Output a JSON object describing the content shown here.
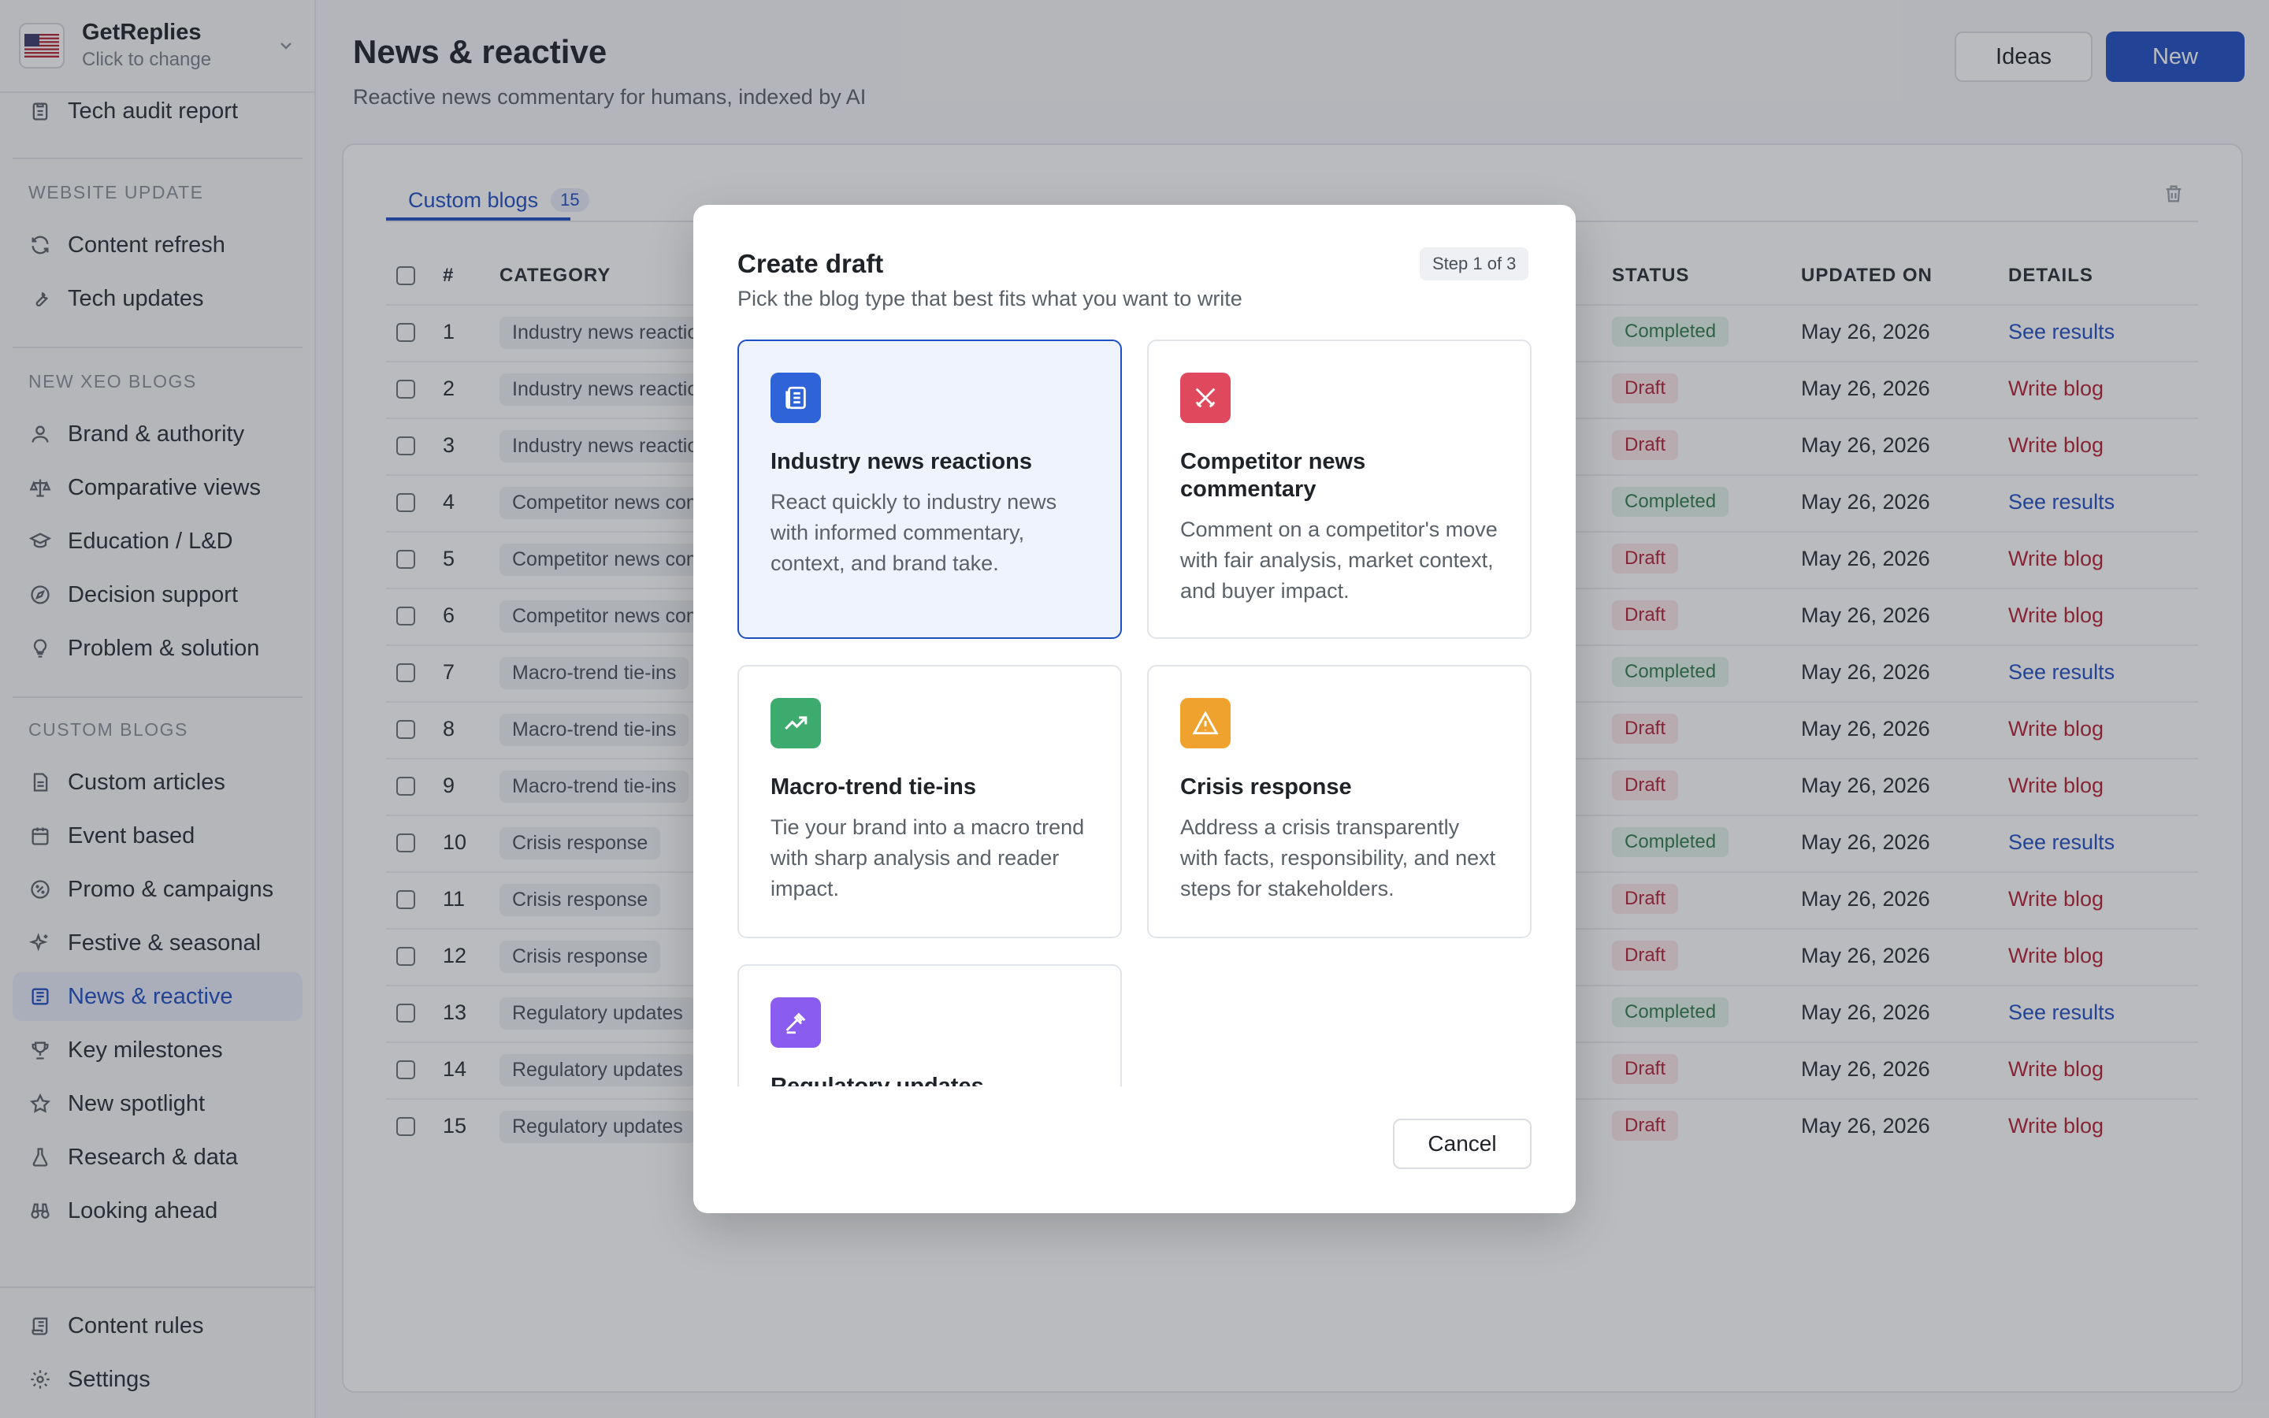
{
  "workspace": {
    "name": "GetReplies",
    "subtitle": "Click to change"
  },
  "sidebar": {
    "top_item": "Tech audit report",
    "sections": [
      {
        "label": "WEBSITE UPDATE",
        "items": [
          "Content refresh",
          "Tech updates"
        ]
      },
      {
        "label": "NEW XEO BLOGS",
        "items": [
          "Brand & authority",
          "Comparative views",
          "Education / L&D",
          "Decision support",
          "Problem & solution"
        ]
      },
      {
        "label": "CUSTOM BLOGS",
        "items": [
          "Custom articles",
          "Event based",
          "Promo & campaigns",
          "Festive & seasonal",
          "News & reactive",
          "Key milestones",
          "New spotlight",
          "Research & data",
          "Looking ahead"
        ]
      }
    ],
    "active_item": "News & reactive",
    "footer": [
      "Content rules",
      "Settings"
    ]
  },
  "header": {
    "title": "News & reactive",
    "subtitle": "Reactive news commentary for humans, indexed by AI",
    "ideas_label": "Ideas",
    "new_label": "New"
  },
  "tabs": [
    {
      "label": "Custom blogs",
      "count": "15"
    }
  ],
  "table": {
    "columns": {
      "num": "#",
      "category": "CATEGORY",
      "status": "STATUS",
      "updated": "UPDATED ON",
      "details": "DETAILS"
    },
    "rows": [
      {
        "num": "1",
        "category": "Industry news reactions",
        "status": "Completed",
        "updated": "May 26, 2026",
        "details": "See results"
      },
      {
        "num": "2",
        "category": "Industry news reactions",
        "status": "Draft",
        "updated": "May 26, 2026",
        "details": "Write blog"
      },
      {
        "num": "3",
        "category": "Industry news reactions",
        "status": "Draft",
        "updated": "May 26, 2026",
        "details": "Write blog"
      },
      {
        "num": "4",
        "category": "Competitor news commentary",
        "status": "Completed",
        "updated": "May 26, 2026",
        "details": "See results"
      },
      {
        "num": "5",
        "category": "Competitor news commentary",
        "status": "Draft",
        "updated": "May 26, 2026",
        "details": "Write blog"
      },
      {
        "num": "6",
        "category": "Competitor news commentary",
        "status": "Draft",
        "updated": "May 26, 2026",
        "details": "Write blog"
      },
      {
        "num": "7",
        "category": "Macro-trend tie-ins",
        "status": "Completed",
        "updated": "May 26, 2026",
        "details": "See results"
      },
      {
        "num": "8",
        "category": "Macro-trend tie-ins",
        "status": "Draft",
        "updated": "May 26, 2026",
        "details": "Write blog"
      },
      {
        "num": "9",
        "category": "Macro-trend tie-ins",
        "status": "Draft",
        "updated": "May 26, 2026",
        "details": "Write blog"
      },
      {
        "num": "10",
        "category": "Crisis response",
        "status": "Completed",
        "updated": "May 26, 2026",
        "details": "See results"
      },
      {
        "num": "11",
        "category": "Crisis response",
        "status": "Draft",
        "updated": "May 26, 2026",
        "details": "Write blog"
      },
      {
        "num": "12",
        "category": "Crisis response",
        "status": "Draft",
        "updated": "May 26, 2026",
        "details": "Write blog"
      },
      {
        "num": "13",
        "category": "Regulatory updates",
        "status": "Completed",
        "updated": "May 26, 2026",
        "details": "See results"
      },
      {
        "num": "14",
        "category": "Regulatory updates",
        "status": "Draft",
        "updated": "May 26, 2026",
        "details": "Write blog"
      },
      {
        "num": "15",
        "category": "Regulatory updates",
        "status": "Draft",
        "updated": "May 26, 2026",
        "details": "Write blog"
      }
    ]
  },
  "modal": {
    "title": "Create draft",
    "subtitle": "Pick the blog type that best fits what you want to write",
    "step": "Step 1 of 3",
    "options": [
      {
        "title": "Industry news reactions",
        "desc": "React quickly to industry news with informed commentary, context, and brand take.",
        "icon": "newspaper-icon",
        "color": "#2f63d8",
        "selected": true
      },
      {
        "title": "Competitor news commentary",
        "desc": "Comment on a competitor's move with fair analysis, market context, and buyer impact.",
        "icon": "crossed-swords-icon",
        "color": "#e0485d",
        "selected": false
      },
      {
        "title": "Macro-trend tie-ins",
        "desc": "Tie your brand into a macro trend with sharp analysis and reader impact.",
        "icon": "trend-up-icon",
        "color": "#3daa6e",
        "selected": false
      },
      {
        "title": "Crisis response",
        "desc": "Address a crisis transparently with facts, responsibility, and next steps for stakeholders.",
        "icon": "warning-icon",
        "color": "#f0a22e",
        "selected": false
      },
      {
        "title": "Regulatory updates",
        "desc": "",
        "icon": "gavel-icon",
        "color": "#8b5cf0",
        "selected": false
      }
    ],
    "cancel_label": "Cancel"
  },
  "colors": {
    "accent": "#1f4fc4",
    "completed": "#2f7d4e",
    "draft": "#b42336"
  }
}
